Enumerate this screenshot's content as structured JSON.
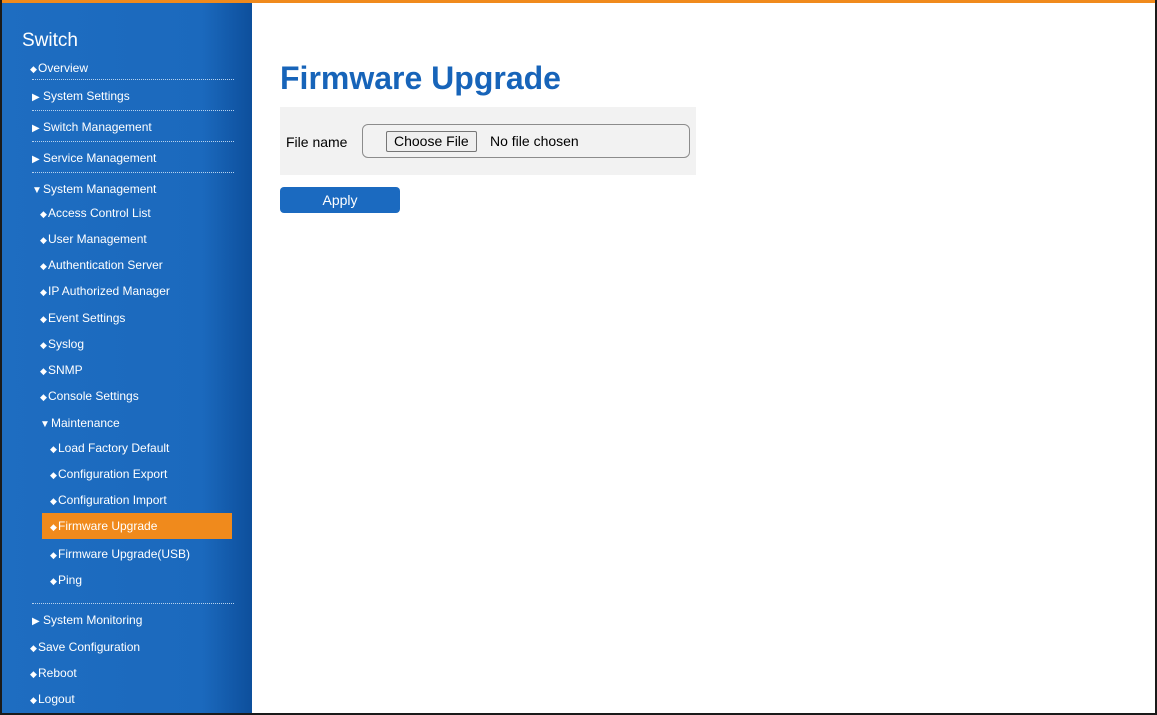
{
  "sidebar": {
    "title": "Switch",
    "nav": {
      "overview": "Overview",
      "system_settings": "System Settings",
      "switch_management": "Switch Management",
      "service_management": "Service Management",
      "system_management": "System Management",
      "access_control_list": "Access Control List",
      "user_management": "User Management",
      "authentication_server": "Authentication Server",
      "ip_authorized_manager": "IP Authorized Manager",
      "event_settings": "Event Settings",
      "syslog": "Syslog",
      "snmp": "SNMP",
      "console_settings": "Console Settings",
      "maintenance": "Maintenance",
      "load_factory_default": "Load Factory Default",
      "configuration_export": "Configuration Export",
      "configuration_import": "Configuration Import",
      "firmware_upgrade": "Firmware Upgrade",
      "firmware_upgrade_usb": "Firmware Upgrade(USB)",
      "ping": "Ping",
      "system_monitoring": "System Monitoring",
      "save_configuration": "Save Configuration",
      "reboot": "Reboot",
      "logout": "Logout"
    },
    "active_item": "Firmware Upgrade",
    "active_color": "#f08a1c"
  },
  "main": {
    "title": "Firmware Upgrade",
    "form": {
      "file_label": "File name",
      "choose_button": "Choose File",
      "file_status": "No file chosen"
    },
    "apply_button": "Apply"
  },
  "icons": {
    "bullet": "◆",
    "collapsed": "▶",
    "expanded": "▼"
  },
  "colors": {
    "brand_blue": "#1764b9",
    "accent_orange": "#f08a1c"
  }
}
